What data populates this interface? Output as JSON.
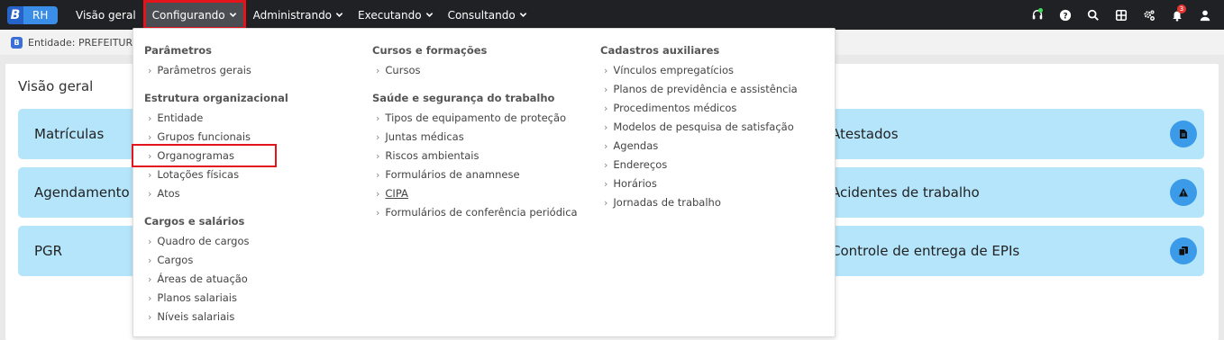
{
  "app": {
    "logo_letter": "B",
    "logo_text": "RH"
  },
  "nav": {
    "items": [
      {
        "label": "Visão geral",
        "has_dropdown": false
      },
      {
        "label": "Configurando",
        "has_dropdown": true,
        "active": true
      },
      {
        "label": "Administrando",
        "has_dropdown": true
      },
      {
        "label": "Executando",
        "has_dropdown": true
      },
      {
        "label": "Consultando",
        "has_dropdown": true
      }
    ]
  },
  "header_icons": {
    "support": "headset-icon",
    "help": "help-icon",
    "search": "search-icon",
    "apps": "apps-grid-icon",
    "settings": "gears-icon",
    "notifications": "bell-icon",
    "notifications_count": "3",
    "user": "user-icon"
  },
  "entity": {
    "label": "Entidade: PREFEITURA D"
  },
  "main": {
    "title": "Visão geral",
    "tiles_left": [
      "Matrículas",
      "Agendamento",
      "PGR"
    ],
    "tiles_right": [
      "Atestados",
      "Acidentes de trabalho",
      "Controle de entrega de EPIs"
    ]
  },
  "dropdown": {
    "col1": {
      "sections": [
        {
          "title": "Parâmetros",
          "items": [
            "Parâmetros gerais"
          ]
        },
        {
          "title": "Estrutura organizacional",
          "items": [
            "Entidade",
            "Grupos funcionais",
            "Organogramas",
            "Lotações físicas",
            "Atos"
          ]
        },
        {
          "title": "Cargos e salários",
          "items": [
            "Quadro de cargos",
            "Cargos",
            "Áreas de atuação",
            "Planos salariais",
            "Níveis salariais"
          ]
        }
      ]
    },
    "col2": {
      "sections": [
        {
          "title": "Cursos e formações",
          "items": [
            "Cursos"
          ]
        },
        {
          "title": "Saúde e segurança do trabalho",
          "items": [
            "Tipos de equipamento de proteção",
            "Juntas médicas",
            "Riscos ambientais",
            "Formulários de anamnese",
            "CIPA",
            "Formulários de conferência periódica"
          ]
        }
      ]
    },
    "col3": {
      "sections": [
        {
          "title": "Cadastros auxiliares",
          "items": [
            "Vínculos empregatícios",
            "Planos de previdência e assistência",
            "Procedimentos médicos",
            "Modelos de pesquisa de satisfação",
            "Agendas",
            "Endereços",
            "Horários",
            "Jornadas de trabalho"
          ]
        }
      ]
    },
    "highlighted_item": "Organogramas"
  },
  "colors": {
    "topbar": "#202124",
    "tile": "#b4e5fb",
    "accent": "#3c9be8",
    "highlight": "#e3141b"
  }
}
